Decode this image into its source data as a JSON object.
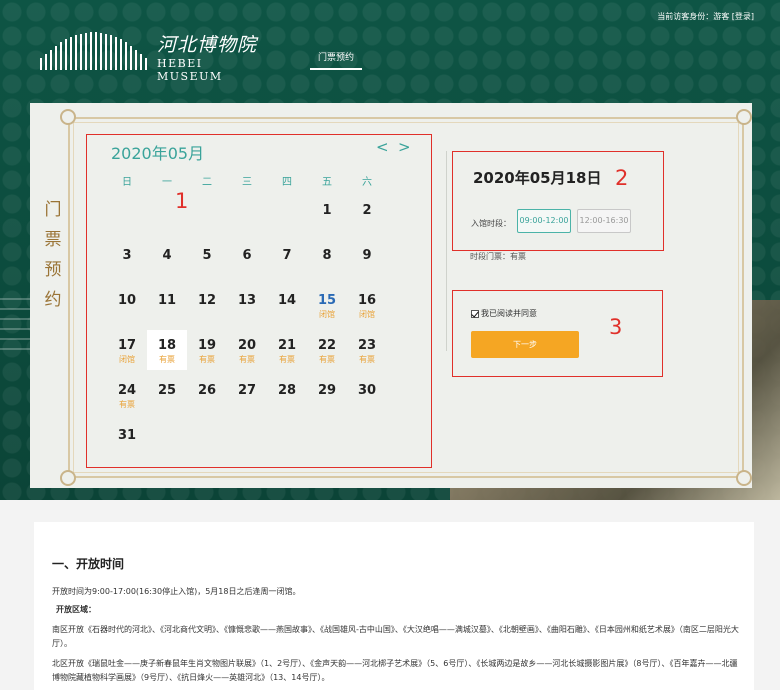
{
  "header": {
    "visitor_prefix": "当前访客身份：游客",
    "login": "[登录]",
    "logo_cn": "河北博物院",
    "logo_en": "HEBEI MUSEUM",
    "nav_tab": "门票预约"
  },
  "booking": {
    "side_title": [
      "门",
      "票",
      "预",
      "约"
    ],
    "calendar": {
      "month_label": "2020年05月",
      "prev": "<",
      "next": ">",
      "weekdays": [
        "日",
        "一",
        "二",
        "三",
        "四",
        "五",
        "六"
      ],
      "days": [
        {
          "d": "1",
          "note": ""
        },
        {
          "d": "2",
          "note": ""
        },
        {
          "d": "3",
          "note": ""
        },
        {
          "d": "4",
          "note": ""
        },
        {
          "d": "5",
          "note": ""
        },
        {
          "d": "6",
          "note": ""
        },
        {
          "d": "7",
          "note": ""
        },
        {
          "d": "8",
          "note": ""
        },
        {
          "d": "9",
          "note": ""
        },
        {
          "d": "10",
          "note": ""
        },
        {
          "d": "11",
          "note": ""
        },
        {
          "d": "12",
          "note": ""
        },
        {
          "d": "13",
          "note": ""
        },
        {
          "d": "14",
          "note": ""
        },
        {
          "d": "15",
          "note": "闭馆"
        },
        {
          "d": "16",
          "note": "闭馆"
        },
        {
          "d": "17",
          "note": "闭馆"
        },
        {
          "d": "18",
          "note": "有票"
        },
        {
          "d": "19",
          "note": "有票"
        },
        {
          "d": "20",
          "note": "有票"
        },
        {
          "d": "21",
          "note": "有票"
        },
        {
          "d": "22",
          "note": "有票"
        },
        {
          "d": "23",
          "note": "有票"
        },
        {
          "d": "24",
          "note": "有票"
        },
        {
          "d": "25",
          "note": ""
        },
        {
          "d": "26",
          "note": ""
        },
        {
          "d": "27",
          "note": ""
        },
        {
          "d": "28",
          "note": ""
        },
        {
          "d": "29",
          "note": ""
        },
        {
          "d": "30",
          "note": ""
        },
        {
          "d": "31",
          "note": ""
        }
      ],
      "first_weekday_index": 5,
      "today": "15",
      "selected": "18"
    },
    "selected_date": "2020年05月18日",
    "slot_label": "入馆时段：",
    "slots": [
      "09:00-12:00",
      "12:00-16:30"
    ],
    "ticket_info": "时段门票：有票",
    "agree_text": "我已阅读并同意",
    "next_button": "下一步",
    "annotations": [
      "1",
      "2",
      "3"
    ]
  },
  "info": {
    "title": "一、开放时间",
    "hours": "开放时间为9:00-17:00(16:30停止入馆)，5月18日之后逢周一闭馆。",
    "area_label": "开放区域：",
    "south": "南区开放《石器时代的河北》、《河北商代文明》、《慷慨悲歌——燕国故事》、《战国雄风-古中山国》、《大汉绝唱——满城汉墓》、《北朝壁画》、《曲阳石雕》、《日本园州和纸艺术展》（南区二层阳光大厅）。",
    "north": "北区开放《瑞鼠吐金——庚子新春鼠年生肖文物图片联展》（1、2号厅）、《金声天韵——河北梆子艺术展》（5、6号厅）、《长城两边是故乡——河北长城摄影图片展》（8号厅）、《百年嘉卉——北疆博物院藏植物科学画展》（9号厅）、《抗日烽火——英雄河北》（13、14号厅）。"
  },
  "colors": {
    "header_green": "#0f4f42",
    "accent_teal": "#3aa39a",
    "status_orange": "#e9a237",
    "button_orange": "#f5a623",
    "annotation_red": "#e0302a",
    "title_brown": "#9a7436"
  }
}
